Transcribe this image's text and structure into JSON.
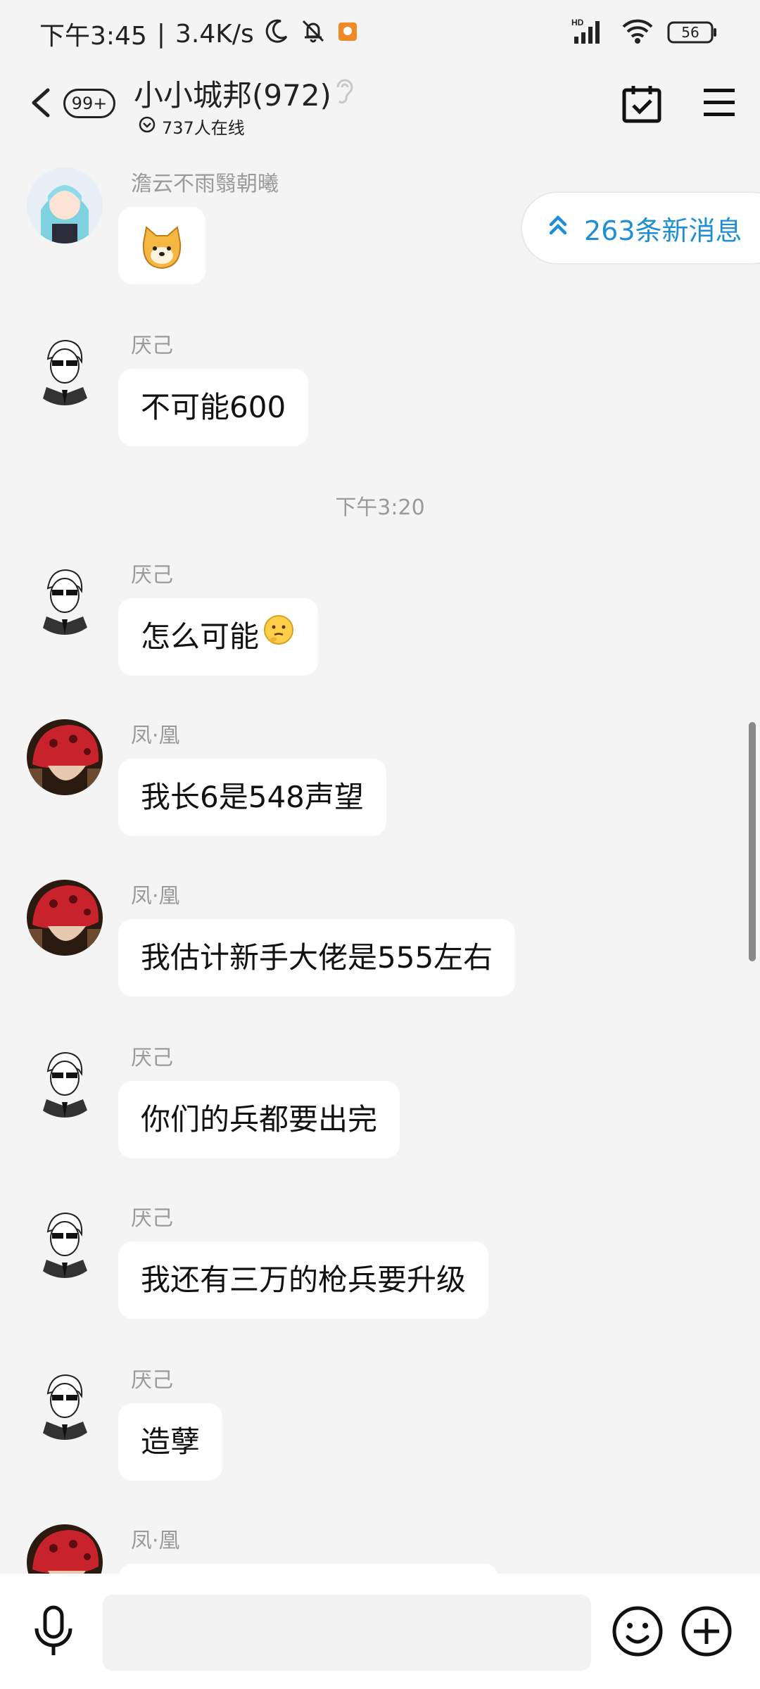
{
  "status_bar": {
    "time": "下午3:45",
    "separator": "|",
    "net_speed": "3.4K/s",
    "battery": "56",
    "network_label": "HD"
  },
  "header": {
    "unread_badge": "99+",
    "group_name": "小小城邦(972)",
    "online_count": "737人在线"
  },
  "chat": {
    "new_messages": "263条新消息",
    "time_separator": "下午3:20",
    "messages": [
      {
        "sender": "澹云不雨翳朝曦",
        "text": ""
      },
      {
        "sender": "厌己",
        "text": "不可能600"
      },
      {
        "sender": "厌己",
        "text": "怎么可能"
      },
      {
        "sender": "凤·凰",
        "text": "我长6是548声望"
      },
      {
        "sender": "凤·凰",
        "text": "我估计新手大佬是555左右"
      },
      {
        "sender": "厌己",
        "text": "你们的兵都要出完"
      },
      {
        "sender": "厌己",
        "text": "我还有三万的枪兵要升级"
      },
      {
        "sender": "厌己",
        "text": "造孽"
      },
      {
        "sender": "凤·凰",
        "text": ""
      }
    ]
  },
  "input": {
    "placeholder": ""
  },
  "colors": {
    "accent": "#1e8fd6",
    "background": "#f4f4f4",
    "bubble": "#ffffff",
    "muted_text": "#9a9a9a"
  }
}
